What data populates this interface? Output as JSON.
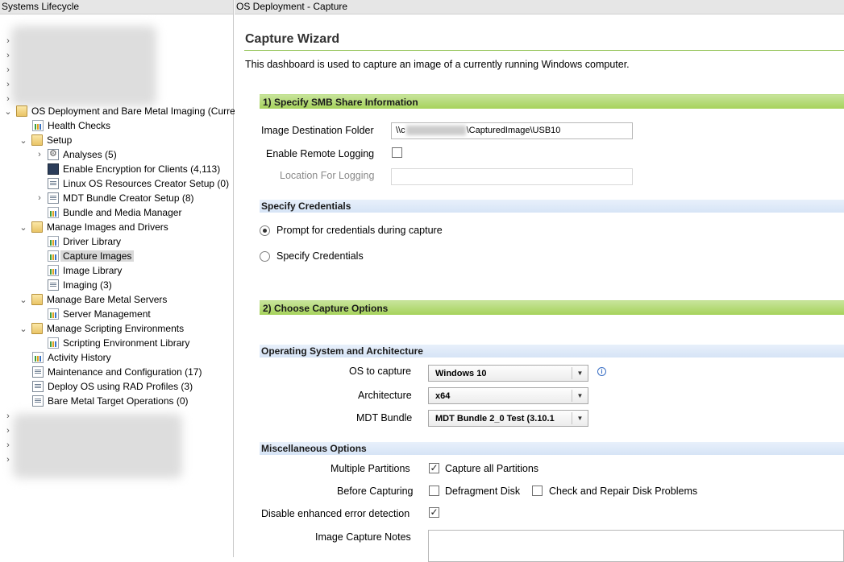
{
  "left_panel": {
    "title": "Systems Lifecycle",
    "tree": {
      "os_deployment": "OS Deployment and Bare Metal Imaging (Curre",
      "health_checks": "Health Checks",
      "setup": "Setup",
      "analyses": "Analyses (5)",
      "enable_encryption": "Enable Encryption for Clients (4,113)",
      "linux_os": "Linux OS Resources Creator Setup (0)",
      "mdt_bundle_setup": "MDT Bundle Creator Setup (8)",
      "bundle_media": "Bundle and Media Manager",
      "manage_images": "Manage Images and Drivers",
      "driver_library": "Driver Library",
      "capture_images": "Capture Images",
      "image_library": "Image Library",
      "imaging": "Imaging (3)",
      "manage_bare_metal": "Manage Bare Metal Servers",
      "server_management": "Server Management",
      "manage_scripting": "Manage Scripting Environments",
      "scripting_library": "Scripting Environment Library",
      "activity_history": "Activity History",
      "maintenance": "Maintenance and Configuration (17)",
      "deploy_os": "Deploy OS using RAD Profiles (3)",
      "bare_metal_target": "Bare Metal Target Operations (0)"
    }
  },
  "right_panel": {
    "title": "OS Deployment - Capture",
    "wizard_title": "Capture Wizard",
    "description": "This dashboard is used to capture an image of a currently running Windows computer.",
    "section1": {
      "header": "1) Specify SMB Share Information",
      "image_dest_label": "Image Destination Folder",
      "image_dest_prefix": "\\\\c",
      "image_dest_suffix": "\\CapturedImage\\USB10",
      "remote_logging_label": "Enable Remote Logging",
      "location_logging_label": "Location For Logging"
    },
    "credentials": {
      "header": "Specify Credentials",
      "prompt_label": "Prompt for credentials during capture",
      "specify_label": "Specify Credentials"
    },
    "section2": {
      "header": "2) Choose Capture Options"
    },
    "os_arch": {
      "header": "Operating System and Architecture",
      "os_label": "OS to capture",
      "os_value": "Windows 10",
      "arch_label": "Architecture",
      "arch_value": "x64",
      "mdt_label": "MDT Bundle",
      "mdt_value": "MDT Bundle 2_0 Test (3.10.1"
    },
    "misc": {
      "header": "Miscellaneous Options",
      "multiple_partitions_label": "Multiple Partitions",
      "capture_all_label": "Capture all Partitions",
      "before_capturing_label": "Before Capturing",
      "defragment_label": "Defragment Disk",
      "check_repair_label": "Check and Repair Disk Problems",
      "disable_error_label": "Disable enhanced error detection",
      "notes_label": "Image Capture Notes"
    },
    "check_mark": "✓",
    "info_glyph": "i",
    "dropdown_glyph": "▼"
  }
}
